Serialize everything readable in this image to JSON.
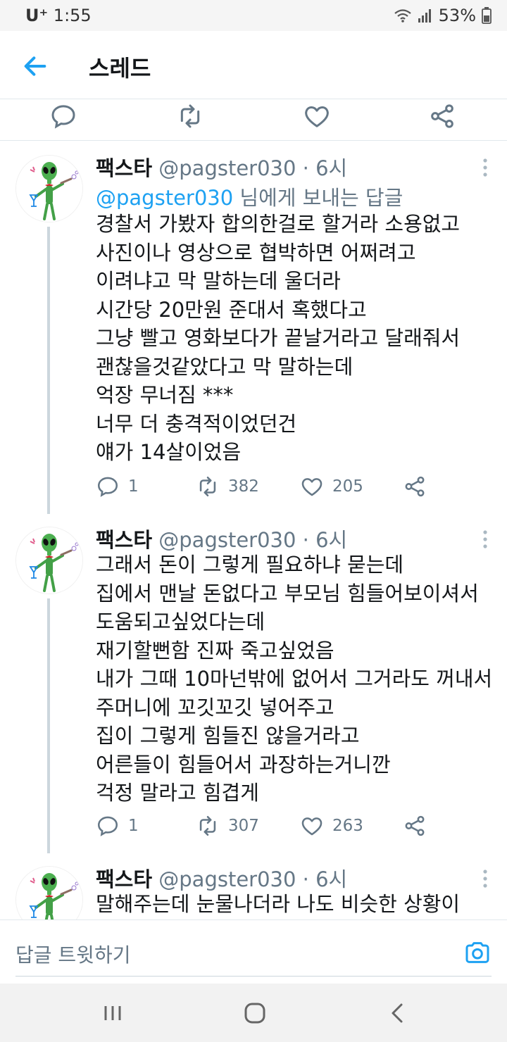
{
  "status_bar": {
    "carrier": "U⁺",
    "time": "1:55",
    "battery": "53%"
  },
  "app_bar": {
    "title": "스레드"
  },
  "tweets": [
    {
      "name": "팩스타",
      "handle": "@pagster030",
      "dot_time": " · 6시",
      "reply_to_handle": "@pagster030",
      "reply_to_suffix": " 님에게 보내는 답글",
      "text": "경찰서 가봤자 합의한걸로 할거라 소용없고\n사진이나 영상으로 협박하면 어쩌려고\n이려냐고 막 말하는데 울더라\n시간당 20만원 준대서 혹했다고\n그냥 빨고 영화보다가 끝날거라고 달래줘서\n괜찮을것같았다고 막 말하는데\n억장 무너짐 ***\n너무 더 충격적이었던건\n얘가 14살이었음",
      "replies": "1",
      "retweets": "382",
      "likes": "205"
    },
    {
      "name": "팩스타",
      "handle": "@pagster030",
      "dot_time": " · 6시",
      "text": "그래서 돈이 그렇게 필요하냐 묻는데\n집에서 맨날 돈없다고 부모님 힘들어보이셔서\n도움되고싶었다는데\n재기할뻔함 진짜 죽고싶었음\n내가 그때 10마넌밖에 없어서 그거라도 꺼내서\n주머니에 꼬깃꼬깃 넣어주고\n집이 그렇게 힘들진 않을거라고\n어른들이 힘들어서 과장하는거니깐\n걱정 말라고 힘겹게",
      "replies": "1",
      "retweets": "307",
      "likes": "263"
    },
    {
      "name": "팩스타",
      "handle": "@pagster030",
      "dot_time": " · 6시",
      "text": "말해주는데 눈물나더라 나도 비슷한 상황이"
    }
  ],
  "reply_bar": {
    "placeholder": "답글 트윗하기"
  },
  "colors": {
    "accent": "#1da1f2",
    "secondary_text": "#657786",
    "divider": "#e1e8ed"
  },
  "icons": [
    "back-arrow-icon",
    "reply-icon",
    "retweet-icon",
    "like-icon",
    "share-icon",
    "more-icon",
    "camera-icon",
    "wifi-icon",
    "signal-icon",
    "battery-icon",
    "recents-icon",
    "home-icon",
    "nav-back-icon"
  ]
}
